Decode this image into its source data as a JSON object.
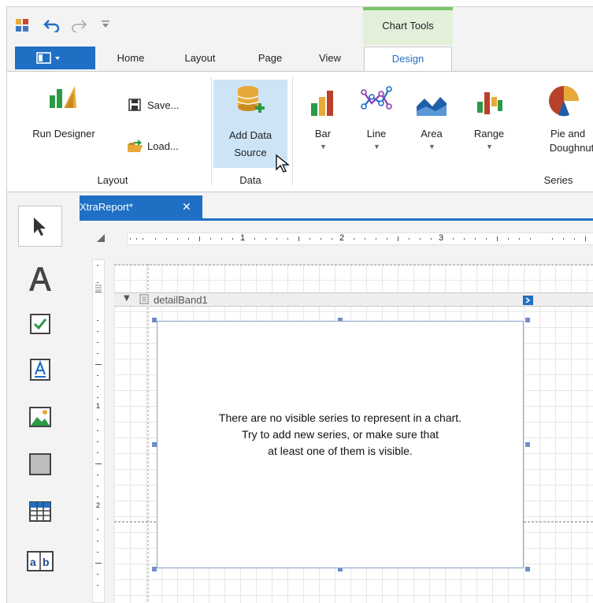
{
  "ribbon": {
    "context_group": "Chart Tools",
    "tabs": [
      "Home",
      "Layout",
      "Page",
      "View",
      "Design"
    ],
    "active_tab": "Design",
    "groups": {
      "layout": {
        "label": "Layout",
        "run_designer": "Run Designer",
        "save": "Save...",
        "load": "Load..."
      },
      "data": {
        "label": "Data",
        "add_data_source_1": "Add Data",
        "add_data_source_2": "Source"
      },
      "series": {
        "label": "Series",
        "bar": "Bar",
        "line": "Line",
        "area": "Area",
        "range": "Range",
        "pie_1": "Pie and",
        "pie_2": "Doughnut"
      }
    }
  },
  "document": {
    "tab_title": "XtraReport*",
    "close_glyph": "✕"
  },
  "ruler": {
    "marks": [
      "1",
      "2",
      "3"
    ],
    "vmarks": [
      "1",
      "2"
    ]
  },
  "band": {
    "name": "detailBand1"
  },
  "chart": {
    "message_line1": "There are no visible series to represent in a chart.",
    "message_line2": "Try to add new series, or make sure that",
    "message_line3": "at least one of them is visible."
  },
  "colors": {
    "accent": "#1f6fc5",
    "context_green": "#7bc36b",
    "highlight": "#cde4f7"
  }
}
